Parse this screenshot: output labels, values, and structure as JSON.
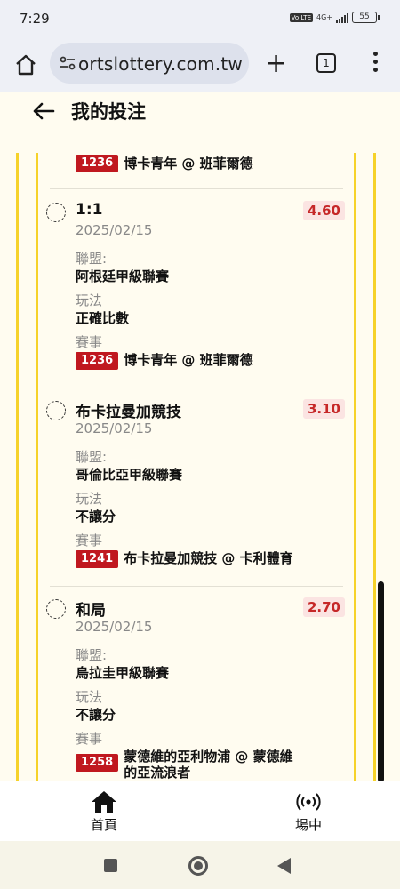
{
  "status_bar": {
    "time": "7:29",
    "network": "4G+",
    "volte": "Vo LTE",
    "battery": "55"
  },
  "browser": {
    "url": "ortslottery.com.tw",
    "tab_count": "1"
  },
  "header": {
    "title": "我的投注"
  },
  "top_partial": {
    "event_code": "1236",
    "event_name": "博卡青年 @ 班菲爾德"
  },
  "bets": [
    {
      "selection": "1:1",
      "date": "2025/02/15",
      "odds": "4.60",
      "league_label": "聯盟:",
      "league": "阿根廷甲級聯賽",
      "market_label": "玩法",
      "market": "正確比數",
      "event_label": "賽事",
      "event_code": "1236",
      "event_name": "博卡青年 @ 班菲爾德"
    },
    {
      "selection": "布卡拉曼加競技",
      "date": "2025/02/15",
      "odds": "3.10",
      "league_label": "聯盟:",
      "league": "哥倫比亞甲級聯賽",
      "market_label": "玩法",
      "market": "不讓分",
      "event_label": "賽事",
      "event_code": "1241",
      "event_name": "布卡拉曼加競技 @ 卡利體育"
    },
    {
      "selection": "和局",
      "date": "2025/02/15",
      "odds": "2.70",
      "league_label": "聯盟:",
      "league": "烏拉圭甲級聯賽",
      "market_label": "玩法",
      "market": "不讓分",
      "event_label": "賽事",
      "event_code": "1258",
      "event_name": "蒙德維的亞利物浦 @ 蒙德維的亞流浪者"
    }
  ],
  "bottom_nav": [
    {
      "label": "首頁",
      "icon": "home-icon"
    },
    {
      "label": "場中",
      "icon": "broadcast-icon"
    }
  ],
  "colors": {
    "accent_yellow": "#f6d22a",
    "odds_red": "#c62828",
    "event_badge": "#c0181f"
  }
}
